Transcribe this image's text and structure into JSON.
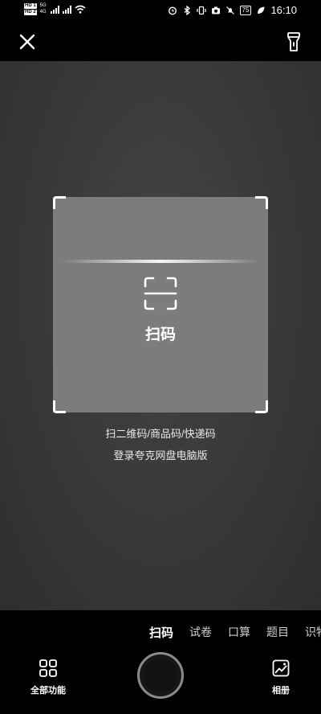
{
  "status_bar": {
    "sim1": "HD 1",
    "sim2": "HD 2",
    "sim1_net": "5G",
    "sim2_net": "4G",
    "battery": "75",
    "time": "16:10",
    "icons": [
      "alarm-icon",
      "bluetooth-icon",
      "vibrate-icon",
      "camera-icon",
      "mute-icon",
      "leaf-icon"
    ]
  },
  "top_bar": {
    "close_icon": "close-icon",
    "flashlight_icon": "flashlight-icon"
  },
  "scanner": {
    "title": "扫码",
    "icon": "scan-icon",
    "hint_line1": "扫二维码/商品码/快递码",
    "hint_line2": "登录夸克网盘电脑版"
  },
  "mode_tabs": [
    {
      "label": "扫码",
      "active": true
    },
    {
      "label": "试卷",
      "active": false
    },
    {
      "label": "口算",
      "active": false
    },
    {
      "label": "题目",
      "active": false
    },
    {
      "label": "识物",
      "active": false
    }
  ],
  "bottom_bar": {
    "all_functions_label": "全部功能",
    "album_label": "相册"
  },
  "colors": {
    "background": "#000000",
    "camera_view": "#3a3a3a",
    "scan_box": "#7c7c7c",
    "shutter_ring": "#8a8a8a"
  }
}
